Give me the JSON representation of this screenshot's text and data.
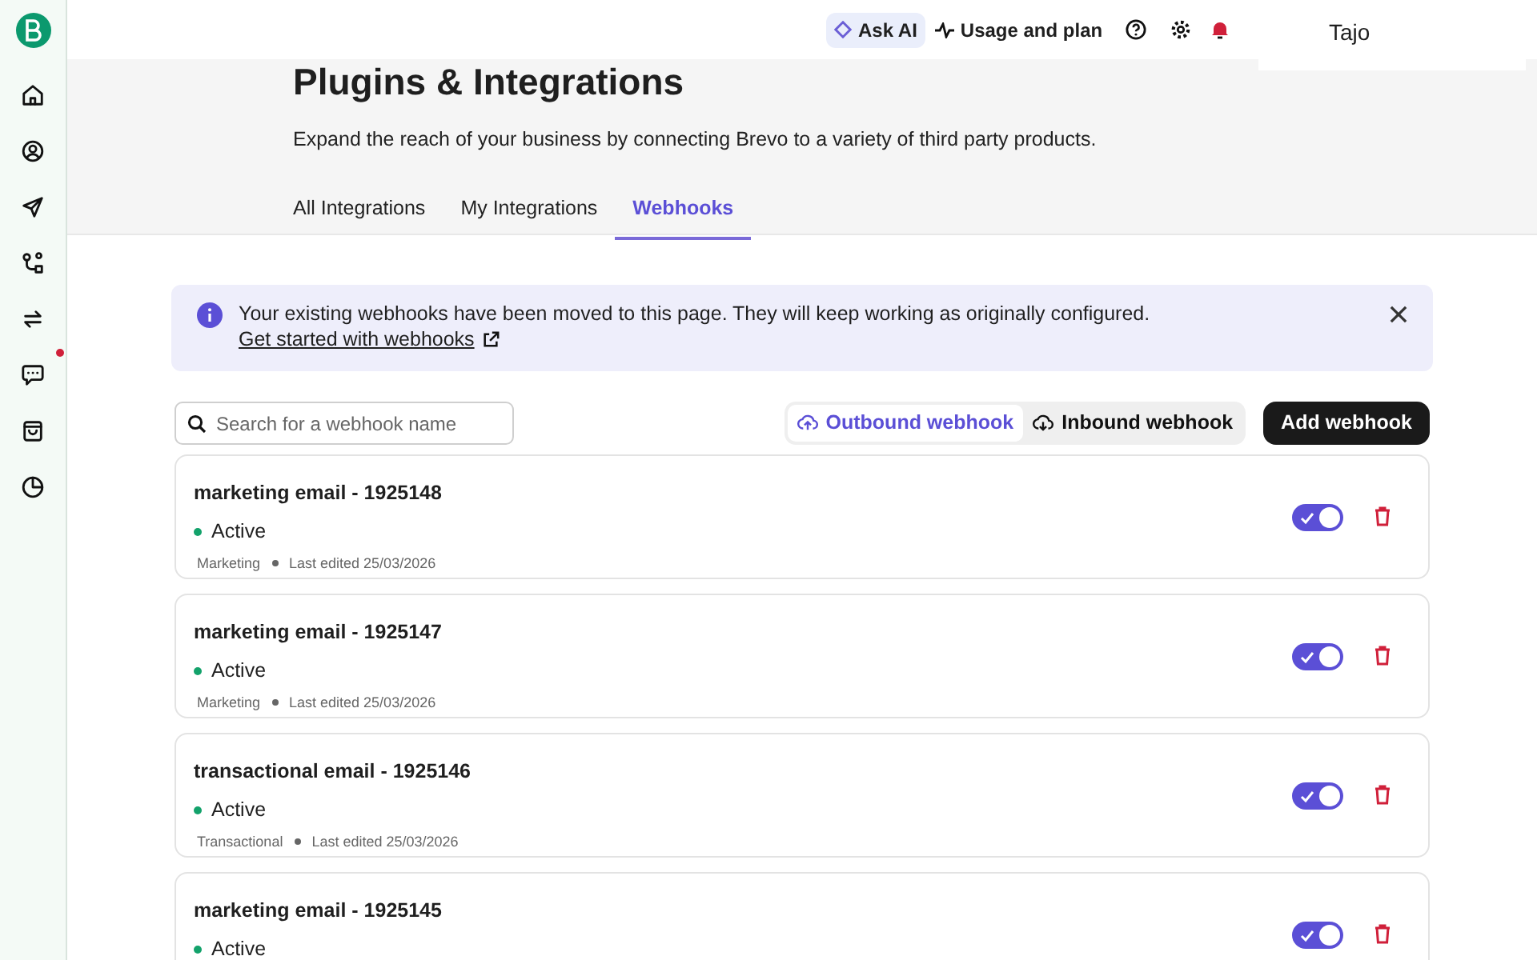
{
  "sidebar": {
    "items": [
      {
        "notification": false
      },
      {
        "notification": false
      },
      {
        "notification": false
      },
      {
        "notification": false
      },
      {
        "notification": false
      },
      {
        "notification": true
      },
      {
        "notification": false
      },
      {
        "notification": false
      }
    ]
  },
  "top_bar": {
    "ask_ai": "Ask AI",
    "usage": "Usage and plan",
    "account": "Tajo"
  },
  "header": {
    "title": "Plugins & Integrations",
    "subtitle": "Expand the reach of your business by connecting Brevo to a variety of third party products."
  },
  "tabs": [
    {
      "label": "All Integrations",
      "selected": false
    },
    {
      "label": "My Integrations",
      "selected": false
    },
    {
      "label": "Webhooks",
      "selected": true
    }
  ],
  "banner": {
    "message": "Your existing webhooks have been moved to this page. They will keep working as originally configured.",
    "link": "Get started with webhooks"
  },
  "search": {
    "placeholder": "Search for a webhook name"
  },
  "direction": [
    {
      "label": "Outbound webhook",
      "kind": "upload",
      "selected": true
    },
    {
      "label": "Inbound webhook",
      "kind": "download",
      "selected": false
    }
  ],
  "add_button": "Add webhook",
  "webhooks": [
    {
      "name": "marketing email - 1925148",
      "status": "Active",
      "color": "#13a26b",
      "on": true,
      "type": "Marketing",
      "edited": "Last edited 25/03/2026"
    },
    {
      "name": "marketing email - 1925147",
      "status": "Active",
      "color": "#13a26b",
      "on": true,
      "type": "Marketing",
      "edited": "Last edited 25/03/2026"
    },
    {
      "name": "transactional email - 1925146",
      "status": "Active",
      "color": "#13a26b",
      "on": true,
      "type": "Transactional",
      "edited": "Last edited 25/03/2026"
    },
    {
      "name": "marketing email - 1925145",
      "status": "Active",
      "color": "#13a26b",
      "on": true
    }
  ]
}
